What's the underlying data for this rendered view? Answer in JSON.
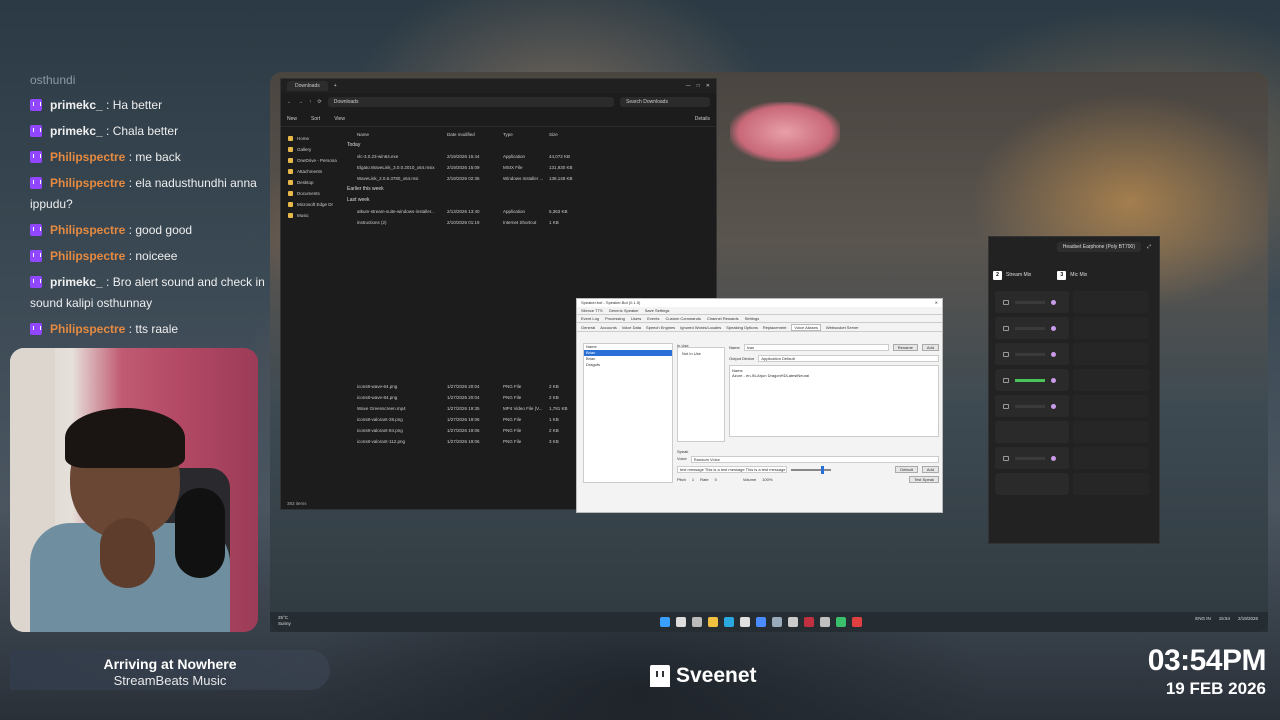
{
  "chat": {
    "faded": "osthundi",
    "messages": [
      {
        "user": "primekc_",
        "text": ": Ha better",
        "style": "white"
      },
      {
        "user": "primekc_",
        "text": ": Chala better",
        "style": "white"
      },
      {
        "user": "Philipspectre",
        "text": ": me back",
        "style": "orange"
      },
      {
        "user": "Philipspectre",
        "text": ": ela nadusthundhi anna ippudu?",
        "style": "orange"
      },
      {
        "user": "Philipspectre",
        "text": ": good good",
        "style": "orange"
      },
      {
        "user": "Philipspectre",
        "text": ": noiceee",
        "style": "orange"
      },
      {
        "user": "primekc_",
        "text": ": Bro alert sound and check in sound kalipi osthunnay",
        "style": "white"
      },
      {
        "user": "Philipspectre",
        "text": ": tts raale",
        "style": "orange"
      }
    ]
  },
  "explorer": {
    "tab": "Downloads",
    "address": "Downloads",
    "search": "Search Downloads",
    "cmd": [
      "New",
      "Sort",
      "View",
      "Details"
    ],
    "sidebar": [
      "Home",
      "Gallery",
      "OneDrive - Persona",
      "Attachments",
      "Desktop",
      "Documents",
      "Microsoft Edge Dr",
      "Music"
    ],
    "headers": [
      "Name",
      "Date modified",
      "Type",
      "Size"
    ],
    "groups": {
      "today": "Today",
      "earlier": "Earlier this week",
      "last": "Last week"
    },
    "rows_today": [
      [
        "vlc-3.0.23-win64.exe",
        "2/19/2026 15:44",
        "Application",
        "44,072 KB"
      ],
      [
        "Elgato.WaveLink_3.0.0.2010_x64.msix",
        "2/19/2026 15:09",
        "MSIX File",
        "131,930 KB"
      ],
      [
        "WaveLink_2.0.6.3780_x64.msi",
        "2/19/2026 02:36",
        "Windows Installer ...",
        "138,148 KB"
      ]
    ],
    "rows_last": [
      [
        "atkum-stream-suite-windows-installer...",
        "2/13/2026 13:40",
        "Application",
        "5,363 KB"
      ],
      [
        "instructions (2)",
        "2/10/2026 01:19",
        "Internet Shortcut",
        "1 KB"
      ]
    ],
    "rows_bottom": [
      [
        "icons8-wave-64.png",
        "1/27/2026 20:04",
        "PNG File",
        "2 KB"
      ],
      [
        "icons8-wave-84.png",
        "1/27/2026 20:04",
        "PNG File",
        "2 KB"
      ],
      [
        "Wave Greenscreen.mp4",
        "1/27/2026 19:35",
        "MP4 Video File (V...",
        "1,781 KB"
      ],
      [
        "icons8-valorant-28.png",
        "1/27/2026 19:06",
        "PNG File",
        "1 KB"
      ],
      [
        "icons8-valorant-84.png",
        "1/27/2026 19:06",
        "PNG File",
        "2 KB"
      ],
      [
        "icons8-valorant-112.png",
        "1/27/2026 19:06",
        "PNG File",
        "3 KB"
      ]
    ],
    "status": "383 items"
  },
  "dialog": {
    "title": "Speaker.bot - Speaker.Bot (0.1.5)",
    "menu": [
      "Silence TTS",
      "Generic Speaker",
      "Save Settings"
    ],
    "tabs1": [
      "Event Log",
      "Processing",
      "Users",
      "Events",
      "Custom Commands",
      "Channel Rewards",
      "Settings"
    ],
    "tabs2": [
      "General",
      "Accounts",
      "Voice Data",
      "Speech Engines",
      "Ignored Words/Locales",
      "Speaking Options",
      "Replacement",
      "Voice Aliases",
      "Websocket Server"
    ],
    "list_header": "Name",
    "list": [
      "Brian",
      "Brian",
      "Dragofs"
    ],
    "inuse_header": "In Use",
    "inuse": "Not In Use",
    "name_label": "Name",
    "name_value": "Ivan",
    "rename": "Rename",
    "add_top": "Add",
    "output_label": "Output Device",
    "output_value": "Application Default",
    "voice_header": "Name",
    "voice_item": "Azure - en-IN-Arjun DragonHDLatestNeural",
    "speak_label": "Speak",
    "voice_label": "Voice",
    "voice_select": "Random Voice",
    "test_text": "test message This is a test message This is a test message",
    "pitch": "Pitch",
    "pitch_val": "1",
    "rate": "Rate",
    "rate_val": "0",
    "volume": "Volume",
    "volume_val": "100%",
    "default_btn": "Default",
    "add_btn": "Add",
    "test_btn": "Test Speak"
  },
  "mixer": {
    "device": "Headset Earphone (Poly BT700)",
    "tabs": [
      {
        "num": "2",
        "label": "Stream Mix"
      },
      {
        "num": "3",
        "label": "Mic Mix"
      }
    ]
  },
  "taskbar": {
    "weather_temp": "25°C",
    "weather_desc": "Sunny",
    "lang": "ENG IN",
    "time": "15:54",
    "date": "2/19/2026"
  },
  "music": {
    "song": "Arriving at Nowhere",
    "artist": "StreamBeats Music"
  },
  "channel": "Sveenet",
  "clock": {
    "time": "03:54PM",
    "date": "19 FEB 2026"
  }
}
